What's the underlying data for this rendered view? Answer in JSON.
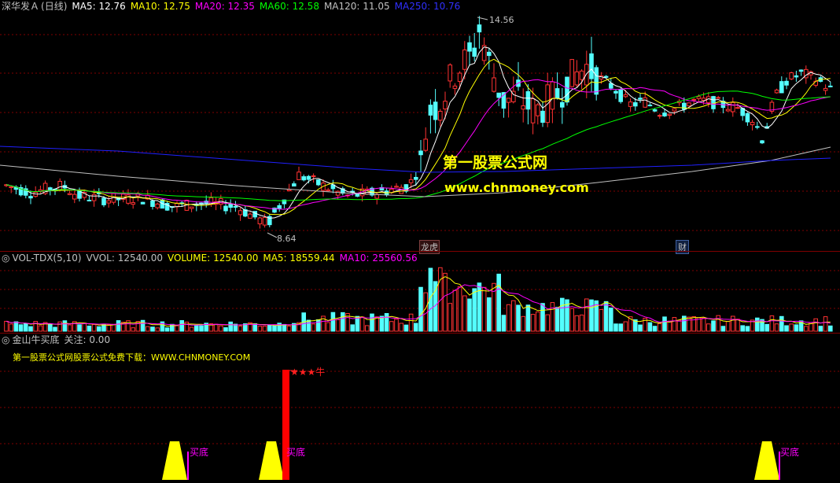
{
  "colors": {
    "up": "#ff3232",
    "down": "#54ffff",
    "ma5": "#ffffff",
    "ma10": "#ffff00",
    "ma20": "#ff00ff",
    "ma60": "#00ff00",
    "ma120": "#c0c0c0",
    "ma250": "#2020ff",
    "grid": "#800000"
  },
  "main_panel": {
    "stock_name": "深华发Ａ",
    "period": "(日线)",
    "ma_labels": [
      {
        "name": "MA5",
        "value": "12.76",
        "color": "#ffffff"
      },
      {
        "name": "MA10",
        "value": "12.75",
        "color": "#ffff00"
      },
      {
        "name": "MA20",
        "value": "12.35",
        "color": "#ff00ff"
      },
      {
        "name": "MA60",
        "value": "12.58",
        "color": "#00ff00"
      },
      {
        "name": "MA120",
        "value": "11.05",
        "color": "#c0c0c0"
      },
      {
        "name": "MA250",
        "value": "10.76",
        "color": "#3030ff"
      }
    ],
    "high_label": "14.56",
    "low_label": "8.64",
    "marker_dragon": "龙虎",
    "marker_finance": "财"
  },
  "watermark": {
    "title": "第一股票公式网",
    "url": "www.chnmoney.com"
  },
  "volume_panel": {
    "name": "VOL-TDX(5,10)",
    "vvol_label": "VVOL: 12540.00",
    "volume_label": "VOLUME: 12540.00",
    "ma5_label": "MA5: 18559.44",
    "ma10_label": "MA10: 25560.56"
  },
  "indicator_panel": {
    "name": "金山牛买底",
    "focus_label": "关注: 0.00",
    "promo": "第一股票公式网股票公式免费下载：WWW.CHNMONEY.COM",
    "buy_label": "买底",
    "star_label": "★★★牛"
  },
  "chart_data": {
    "type": "candlestick",
    "price_range": [
      8.64,
      14.56
    ],
    "high": 14.56,
    "low": 8.64
  }
}
